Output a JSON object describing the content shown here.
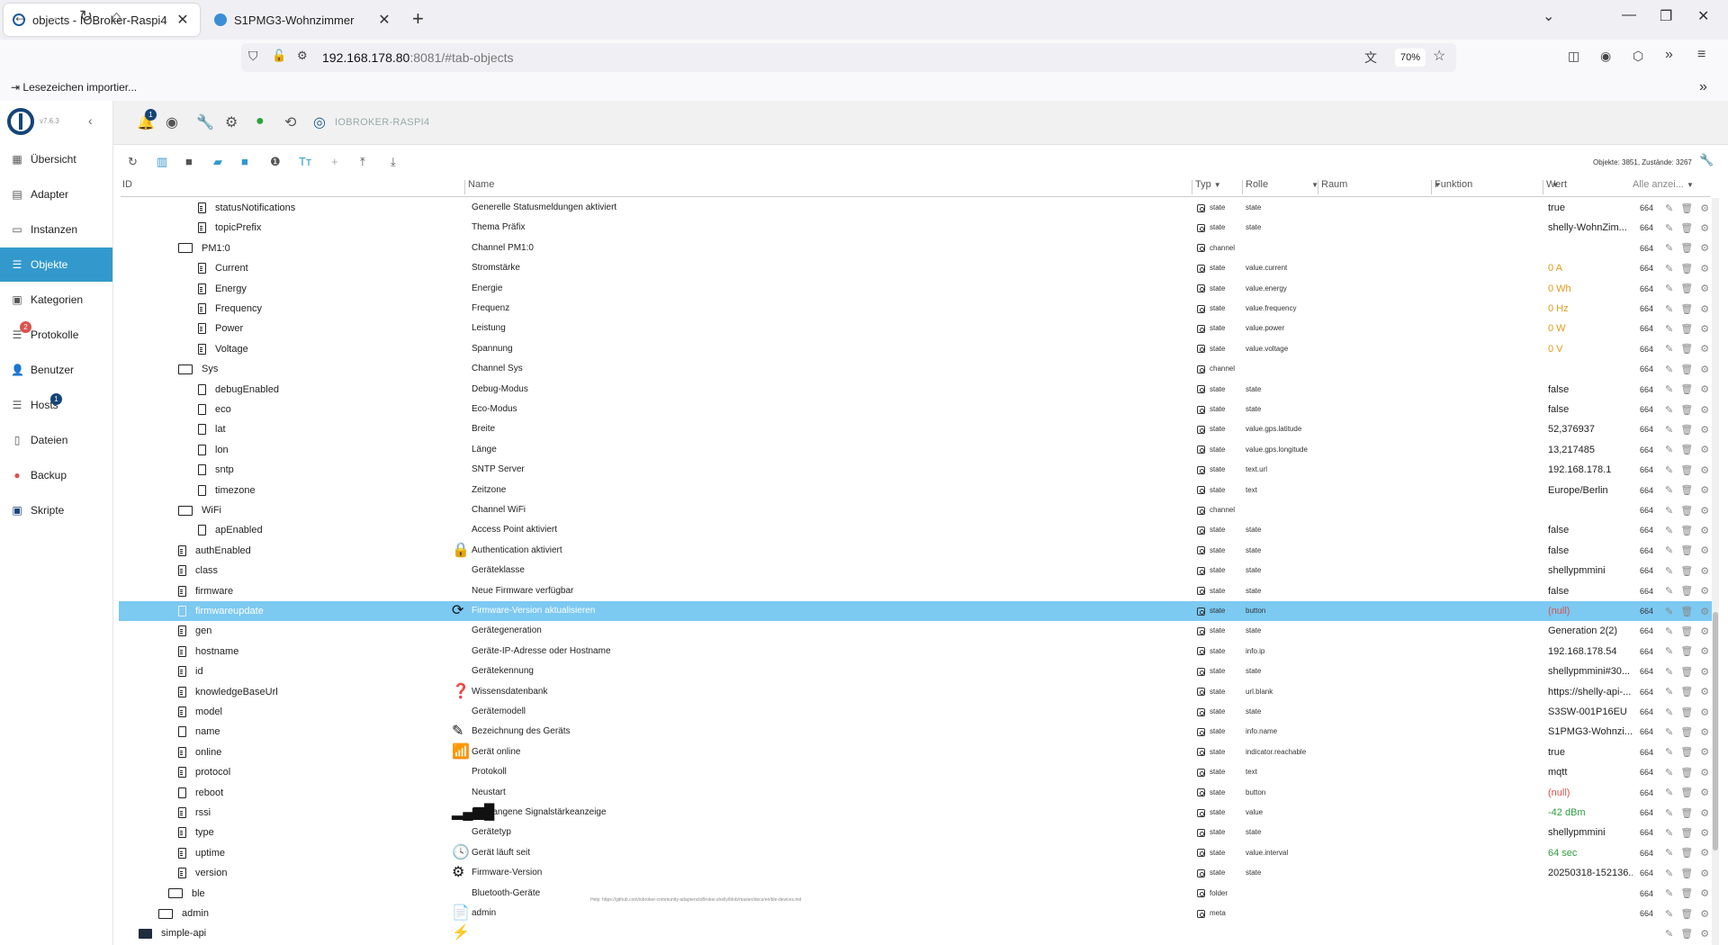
{
  "browser": {
    "tabs": [
      {
        "title": "objects - IOBroker-Raspi4",
        "active": true
      },
      {
        "title": "S1PMG3-Wohnzimmer",
        "active": false
      }
    ],
    "url_host": "192.168.178.80",
    "url_rest": ":8081/#tab-objects",
    "zoom": "70%",
    "bookmark": "Lesezeichen importier..."
  },
  "app": {
    "version": "v7.6.3",
    "host_name": "IOBROKER-RASPI4",
    "notification_count": "1",
    "stats": "Objekte: 3851, Zustände: 3267"
  },
  "sidebar": {
    "items": [
      {
        "label": "Übersicht",
        "icon": "grid-icon"
      },
      {
        "label": "Adapter",
        "icon": "store-icon"
      },
      {
        "label": "Instanzen",
        "icon": "list-icon"
      },
      {
        "label": "Objekte",
        "icon": "objects-icon",
        "active": true
      },
      {
        "label": "Kategorien",
        "icon": "category-icon"
      },
      {
        "label": "Protokolle",
        "icon": "log-icon",
        "badge": "2"
      },
      {
        "label": "Benutzer",
        "icon": "user-icon"
      },
      {
        "label": "Hosts",
        "icon": "hosts-icon",
        "badge": "1"
      },
      {
        "label": "Dateien",
        "icon": "files-icon"
      },
      {
        "label": "Backup",
        "icon": "backup-icon"
      },
      {
        "label": "Skripte",
        "icon": "scripts-icon"
      }
    ]
  },
  "columns": {
    "id": "ID",
    "name": "Name",
    "type": "Typ",
    "role": "Rolle",
    "room": "Raum",
    "function": "Funktion",
    "value": "Wert",
    "acl": "Alle anzei..."
  },
  "rows": [
    {
      "id": "statusNotifications",
      "ind": 2,
      "icon": "file",
      "name": "Generelle Statusmeldungen aktiviert",
      "type": "state",
      "role": "state",
      "value": "true",
      "vc": "norm",
      "acl": "664"
    },
    {
      "id": "topicPrefix",
      "ind": 2,
      "icon": "file",
      "name": "Thema Präfix",
      "type": "state",
      "role": "state",
      "value": "shelly-WohnZim...",
      "vc": "norm",
      "acl": "664"
    },
    {
      "id": "PM1:0",
      "ind": 1,
      "icon": "open",
      "name": "Channel PM1:0",
      "type": "channel",
      "role": "",
      "value": "",
      "vc": "norm",
      "acl": "664"
    },
    {
      "id": "Current",
      "ind": 2,
      "icon": "file",
      "name": "Stromstärke",
      "type": "state",
      "role": "value.current",
      "value": "0 A",
      "vc": "orange",
      "acl": "664"
    },
    {
      "id": "Energy",
      "ind": 2,
      "icon": "file",
      "name": "Energie",
      "type": "state",
      "role": "value.energy",
      "value": "0 Wh",
      "vc": "orange",
      "acl": "664"
    },
    {
      "id": "Frequency",
      "ind": 2,
      "icon": "file",
      "name": "Frequenz",
      "type": "state",
      "role": "value.frequency",
      "value": "0 Hz",
      "vc": "orange",
      "acl": "664"
    },
    {
      "id": "Power",
      "ind": 2,
      "icon": "file",
      "name": "Leistung",
      "type": "state",
      "role": "value.power",
      "value": "0 W",
      "vc": "orange",
      "acl": "664"
    },
    {
      "id": "Voltage",
      "ind": 2,
      "icon": "file",
      "name": "Spannung",
      "type": "state",
      "role": "value.voltage",
      "value": "0 V",
      "vc": "orange",
      "acl": "664"
    },
    {
      "id": "Sys",
      "ind": 1,
      "icon": "open",
      "name": "Channel Sys",
      "type": "channel",
      "role": "",
      "value": "",
      "vc": "norm",
      "acl": "664"
    },
    {
      "id": "debugEnabled",
      "ind": 2,
      "icon": "doc",
      "name": "Debug-Modus",
      "type": "state",
      "role": "state",
      "value": "false",
      "vc": "norm",
      "acl": "664"
    },
    {
      "id": "eco",
      "ind": 2,
      "icon": "doc",
      "name": "Eco-Modus",
      "type": "state",
      "role": "state",
      "value": "false",
      "vc": "norm",
      "acl": "664"
    },
    {
      "id": "lat",
      "ind": 2,
      "icon": "doc",
      "name": "Breite",
      "type": "state",
      "role": "value.gps.latitude",
      "value": "52,376937",
      "vc": "norm",
      "acl": "664"
    },
    {
      "id": "lon",
      "ind": 2,
      "icon": "doc",
      "name": "Länge",
      "type": "state",
      "role": "value.gps.longitude",
      "value": "13,217485",
      "vc": "norm",
      "acl": "664"
    },
    {
      "id": "sntp",
      "ind": 2,
      "icon": "doc",
      "name": "SNTP Server",
      "type": "state",
      "role": "text.url",
      "value": "192.168.178.1",
      "vc": "norm",
      "acl": "664"
    },
    {
      "id": "timezone",
      "ind": 2,
      "icon": "doc",
      "name": "Zeitzone",
      "type": "state",
      "role": "text",
      "value": "Europe/Berlin",
      "vc": "norm",
      "acl": "664"
    },
    {
      "id": "WiFi",
      "ind": 1,
      "icon": "open",
      "name": "Channel WiFi",
      "type": "channel",
      "role": "",
      "value": "",
      "vc": "norm",
      "acl": "664"
    },
    {
      "id": "apEnabled",
      "ind": 2,
      "icon": "doc",
      "name": "Access Point aktiviert",
      "type": "state",
      "role": "state",
      "value": "false",
      "vc": "norm",
      "acl": "664"
    },
    {
      "id": "authEnabled",
      "ind": 1,
      "icon": "file",
      "name": "Authentication aktiviert",
      "nicon": "🔒",
      "type": "state",
      "role": "state",
      "value": "false",
      "vc": "norm",
      "acl": "664"
    },
    {
      "id": "class",
      "ind": 1,
      "icon": "file",
      "name": "Geräteklasse",
      "type": "state",
      "role": "state",
      "value": "shellypmmini",
      "vc": "norm",
      "acl": "664"
    },
    {
      "id": "firmware",
      "ind": 1,
      "icon": "file",
      "name": "Neue Firmware verfügbar",
      "type": "state",
      "role": "state",
      "value": "false",
      "vc": "norm",
      "acl": "664"
    },
    {
      "id": "firmwareupdate",
      "ind": 1,
      "icon": "doc",
      "name": "Firmware-Version aktualisieren",
      "nicon": "⟳",
      "type": "state",
      "role": "button",
      "value": "(null)",
      "vc": "red",
      "acl": "664",
      "selected": true
    },
    {
      "id": "gen",
      "ind": 1,
      "icon": "file",
      "name": "Gerätegeneration",
      "type": "state",
      "role": "state",
      "value": "Generation 2(2)",
      "vc": "norm",
      "acl": "664"
    },
    {
      "id": "hostname",
      "ind": 1,
      "icon": "file",
      "name": "Geräte-IP-Adresse oder Hostname",
      "type": "state",
      "role": "info.ip",
      "value": "192.168.178.54",
      "vc": "norm",
      "acl": "664"
    },
    {
      "id": "id",
      "ind": 1,
      "icon": "file",
      "name": "Gerätekennung",
      "type": "state",
      "role": "state",
      "value": "shellypmmini#30...",
      "vc": "norm",
      "acl": "664"
    },
    {
      "id": "knowledgeBaseUrl",
      "ind": 1,
      "icon": "file",
      "name": "Wissensdatenbank",
      "nicon": "❓",
      "type": "state",
      "role": "url.blank",
      "value": "https://shelly-api-...",
      "vc": "norm",
      "acl": "664"
    },
    {
      "id": "model",
      "ind": 1,
      "icon": "file",
      "name": "Gerätemodell",
      "type": "state",
      "role": "state",
      "value": "S3SW-001P16EU",
      "vc": "norm",
      "acl": "664"
    },
    {
      "id": "name",
      "ind": 1,
      "icon": "doc",
      "name": "Bezeichnung des Geräts",
      "nicon": "✎",
      "type": "state",
      "role": "info.name",
      "value": "S1PMG3-Wohnzi...",
      "vc": "norm",
      "acl": "664"
    },
    {
      "id": "online",
      "ind": 1,
      "icon": "file",
      "name": "Gerät online",
      "nicon": "📶",
      "type": "state",
      "role": "indicator.reachable",
      "value": "true",
      "vc": "norm",
      "acl": "664"
    },
    {
      "id": "protocol",
      "ind": 1,
      "icon": "file",
      "name": "Protokoll",
      "type": "state",
      "role": "text",
      "value": "mqtt",
      "vc": "norm",
      "acl": "664"
    },
    {
      "id": "reboot",
      "ind": 1,
      "icon": "doc",
      "name": "Neustart",
      "type": "state",
      "role": "button",
      "value": "(null)",
      "vc": "red",
      "acl": "664"
    },
    {
      "id": "rssi",
      "ind": 1,
      "icon": "file",
      "name": "Empfangene Signalstärkeanzeige",
      "nicon": "▂▄▆█",
      "type": "state",
      "role": "value",
      "value": "-42 dBm",
      "vc": "green",
      "acl": "664"
    },
    {
      "id": "type",
      "ind": 1,
      "icon": "file",
      "name": "Gerätetyp",
      "type": "state",
      "role": "state",
      "value": "shellypmmini",
      "vc": "norm",
      "acl": "664"
    },
    {
      "id": "uptime",
      "ind": 1,
      "icon": "file",
      "name": "Gerät läuft seit",
      "nicon": "🕓",
      "type": "state",
      "role": "value.interval",
      "value": "64 sec",
      "vc": "green",
      "acl": "664"
    },
    {
      "id": "version",
      "ind": 1,
      "icon": "file",
      "name": "Firmware-Version",
      "nicon": "⚙",
      "type": "state",
      "role": "state",
      "value": "20250318-152136...",
      "vc": "norm",
      "acl": "664"
    },
    {
      "id": "ble",
      "ind": 0.5,
      "icon": "open",
      "name": "Bluetooth-Geräte",
      "help": "Help: https://github.com/iobroker-community-adapters/ioBroker.shelly/blob/master/docs/en/ble-devices.md",
      "type": "folder",
      "role": "",
      "value": "",
      "vc": "norm",
      "acl": "664"
    },
    {
      "id": "admin",
      "ind": 0,
      "icon": "open",
      "name": "admin",
      "nicon": "📄",
      "type": "meta",
      "role": "",
      "value": "",
      "vc": "norm",
      "acl": "664"
    },
    {
      "id": "simple-api",
      "ind": -1,
      "icon": "folder",
      "name": "",
      "nicon": "⚡",
      "type": "",
      "role": "",
      "value": "",
      "vc": "norm",
      "acl": ""
    }
  ],
  "colors": {
    "accent": "#3399cc",
    "selected_row": "#7cc9f2",
    "value_orange": "#e09a1a",
    "value_red": "#d9534f",
    "value_green": "#2e9b3d"
  }
}
